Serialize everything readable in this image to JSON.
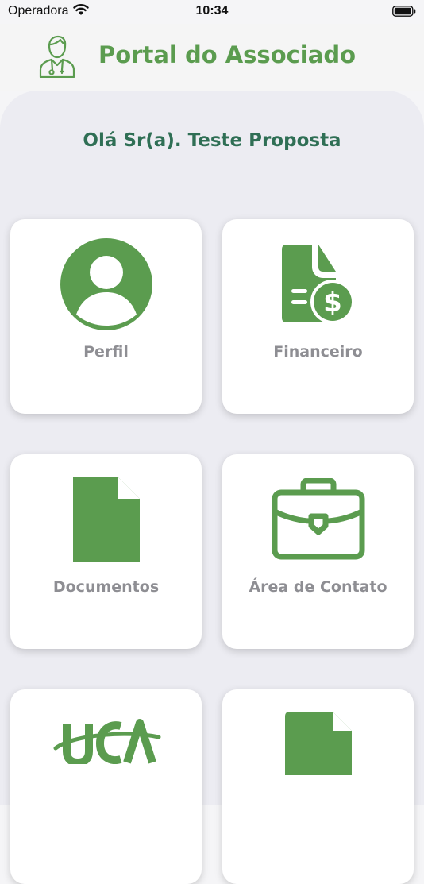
{
  "status_bar": {
    "carrier": "Operadora",
    "time": "10:34"
  },
  "header": {
    "title": "Portal do Associado"
  },
  "greeting": "Olá Sr(a). Teste Proposta",
  "colors": {
    "accent": "#5b9c4f",
    "greeting": "#2f6f55",
    "label": "#8e8e93",
    "background": "#ececf2"
  },
  "menu": [
    {
      "label": "Perfil",
      "icon": "profile-icon"
    },
    {
      "label": "Financeiro",
      "icon": "finance-icon"
    },
    {
      "label": "Documentos",
      "icon": "document-icon"
    },
    {
      "label": "Área de Contato",
      "icon": "briefcase-icon"
    },
    {
      "label": "",
      "icon": "uca-logo-icon"
    },
    {
      "label": "",
      "icon": "truck-icon"
    }
  ]
}
